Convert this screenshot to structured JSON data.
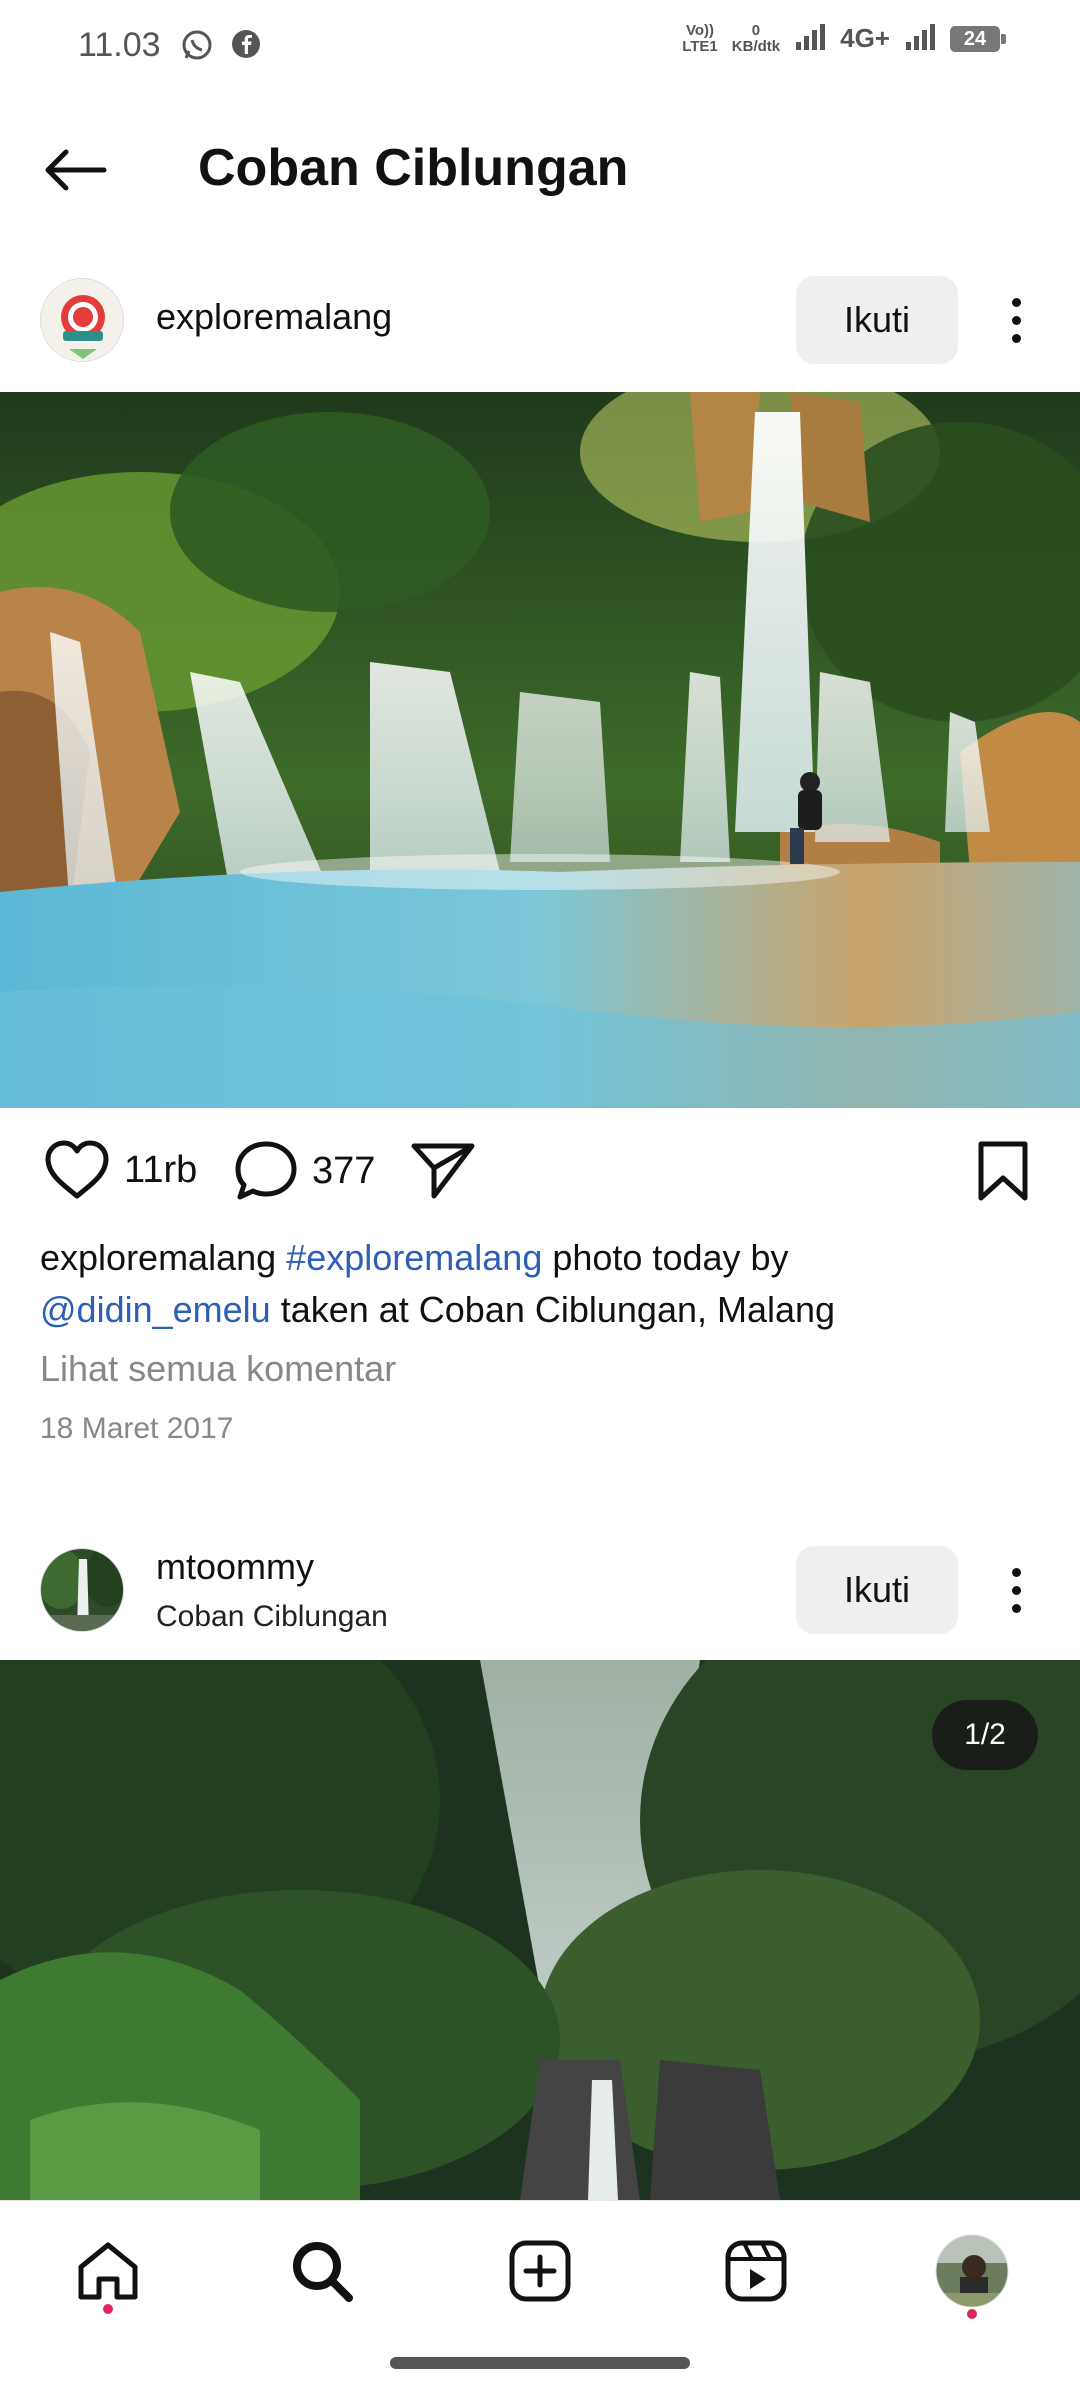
{
  "status_bar": {
    "time": "11.03",
    "net_volte_top": "Vo))",
    "net_volte_bottom": "LTE1",
    "speed_top": "0",
    "speed_bottom": "KB/dtk",
    "network": "4G+",
    "battery": "24"
  },
  "header": {
    "title": "Coban Ciblungan"
  },
  "post1": {
    "username": "exploremalang",
    "follow_label": "Ikuti",
    "likes": "11rb",
    "comments": "377",
    "caption_user": "exploremalang",
    "caption_hashtag": "#exploremalang",
    "caption_text1": " photo today by",
    "caption_mention": "@didin_emelu",
    "caption_text2": " taken at Coban Ciblungan, Malang",
    "view_comments": "Lihat semua komentar",
    "date": "18 Maret 2017"
  },
  "post2": {
    "username": "mtoommy",
    "location": "Coban Ciblungan",
    "follow_label": "Ikuti",
    "pager": "1/2"
  },
  "icons": {
    "back": "arrow-left-icon",
    "like": "heart-icon",
    "comment": "comment-icon",
    "share": "send-icon",
    "save": "bookmark-icon",
    "more": "more-vertical-icon"
  },
  "colors": {
    "link": "#2c5fb5",
    "button_bg": "#efefef",
    "notification_dot": "#e0245e"
  }
}
